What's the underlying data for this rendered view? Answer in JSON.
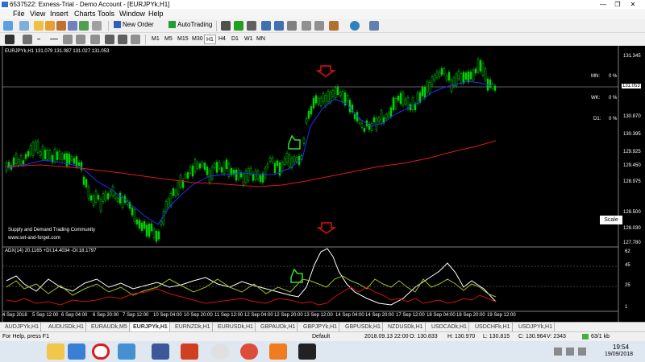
{
  "window": {
    "title": "6537522: Exness-Trial - Demo Account - [EURJPYk,H1]",
    "min_glyph": "—",
    "restore_glyph": "❐",
    "close_glyph": "✕"
  },
  "menu": [
    "File",
    "View",
    "Insert",
    "Charts",
    "Tools",
    "Window",
    "Help"
  ],
  "toolbar": {
    "new_order": "New Order",
    "auto_trading": "AutoTrading",
    "timeframes": [
      "M1",
      "M5",
      "M15",
      "M30",
      "H1",
      "H4",
      "D1",
      "W1",
      "MN"
    ],
    "active_timeframe": "H1"
  },
  "chart": {
    "header": "EURJPYk,H1  131.079 131.087 131.027 131.053",
    "price_labels": [
      "131.345",
      "131.053",
      "130.870",
      "130.395",
      "129.925",
      "129.450",
      "128.975",
      "128.500",
      "128.030",
      "127.780"
    ],
    "current_price": "131.053",
    "mn_label": "MN:",
    "mn_value": "0 %",
    "wk_label": "WK:",
    "wk_value": "0 %",
    "d1_label": "D1:",
    "d1_value": "0 %",
    "watermark_line1": "Supply and Demand Trading Community",
    "watermark_line2": "www.set-and-forget.com",
    "scale_button": "Scale",
    "adx_header": "ADX(14) 20.1165 +DI:14.4034 -DI:18.1797",
    "adx_levels": [
      "62",
      "45",
      "25",
      "1"
    ],
    "time_labels": [
      "4 Sep 2018",
      "5 Sep 12:00",
      "6 Sep 04:00",
      "6 Sep 20:00",
      "7 Sep 12:00",
      "10 Sep 04:00",
      "10 Sep 20:00",
      "11 Sep 12:00",
      "12 Sep 04:00",
      "12 Sep 20:00",
      "13 Sep 12:00",
      "14 Sep 04:00",
      "14 Sep 20:00",
      "17 Sep 12:00",
      "18 Sep 04:00",
      "18 Sep 20:00",
      "19 Sep 12:00"
    ],
    "colors": {
      "candle": "#00d000",
      "ma_fast": "#2a2aff",
      "ma_slow": "#e01818",
      "adx": "#ffffff",
      "plus_di": "#9ac21e",
      "minus_di": "#d01010",
      "arrow_down": "#e01010",
      "arrow_up": "#30e030"
    }
  },
  "tabs": [
    "AUDJPYk,H1",
    "AUDUSDk,H1",
    "EURAUDk,M5",
    "EURJPYk,H1",
    "EURNZDk,H1",
    "EURUSDk,H1",
    "GBPAUDk,H1",
    "GBPJPYk,H1",
    "GBPUSDk,H1",
    "NZDUSDk,H1",
    "USDCADk,H1",
    "USDCHFk,H1",
    "USDJPYk,H1"
  ],
  "active_tab": "EURJPYk,H1",
  "status": {
    "help": "For Help, press F1",
    "profile": "Default",
    "datetime": "2018.09.13 22:00",
    "open": "O: 130.833",
    "high": "H: 130.970",
    "low": "L: 130.815",
    "close": "C: 130.964",
    "volume": "V: 2343",
    "traffic": "63/1 kb"
  },
  "taskbar": {
    "time": "19:54",
    "date": "19/09/2018",
    "apps": [
      "file-explorer-icon",
      "video-player-icon",
      "opera-icon",
      "settings-app-icon",
      "facebook-icon",
      "media-icon",
      "google-search-icon",
      "chrome-icon",
      "avast-icon",
      "exness-terminal-icon"
    ]
  }
}
